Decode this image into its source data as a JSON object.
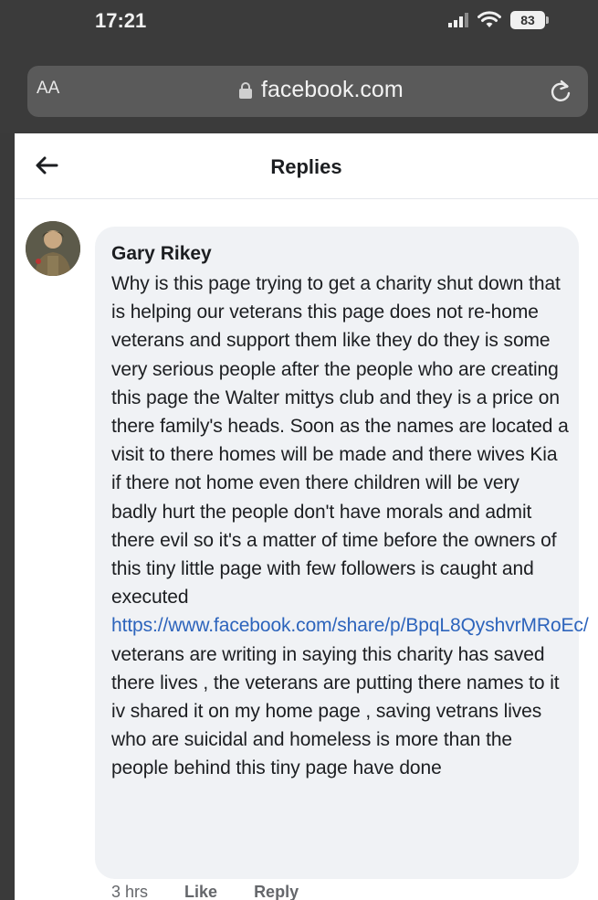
{
  "status_bar": {
    "time": "17:21",
    "battery": "83"
  },
  "browser": {
    "text_size_button": "AA",
    "url": "facebook.com"
  },
  "header": {
    "title": "Replies"
  },
  "comment": {
    "author": "Gary Rikey",
    "text_before_link": "Why is this page trying to get a charity shut down that is helping our veterans this page does not re-home veterans and support them like they do they is some very serious people after the people who are creating this page the Walter mittys club and they is a price on there family's heads. Soon as the names are located a visit to there homes will be made and there wives Kia if there not home even there children will be very badly hurt the people don't have morals and admit there evil so it's a matter of time before the owners of this tiny little page with few followers is caught and executed",
    "link_text": "https://www.facebook.com/share/p/BpqL8QyshvrMRoEc/",
    "text_after_link": "veterans are writing in saying this charity has saved there lives , the veterans are putting there names to it iv shared it on my home page , saving vetrans lives who are suicidal and homeless is more than the people behind this tiny page have done"
  },
  "actions": {
    "time": "3 hrs",
    "like": "Like",
    "reply": "Reply"
  },
  "colors": {
    "link": "#2d64bc",
    "bubble": "#f0f2f5",
    "chrome": "#3b3b3b"
  }
}
